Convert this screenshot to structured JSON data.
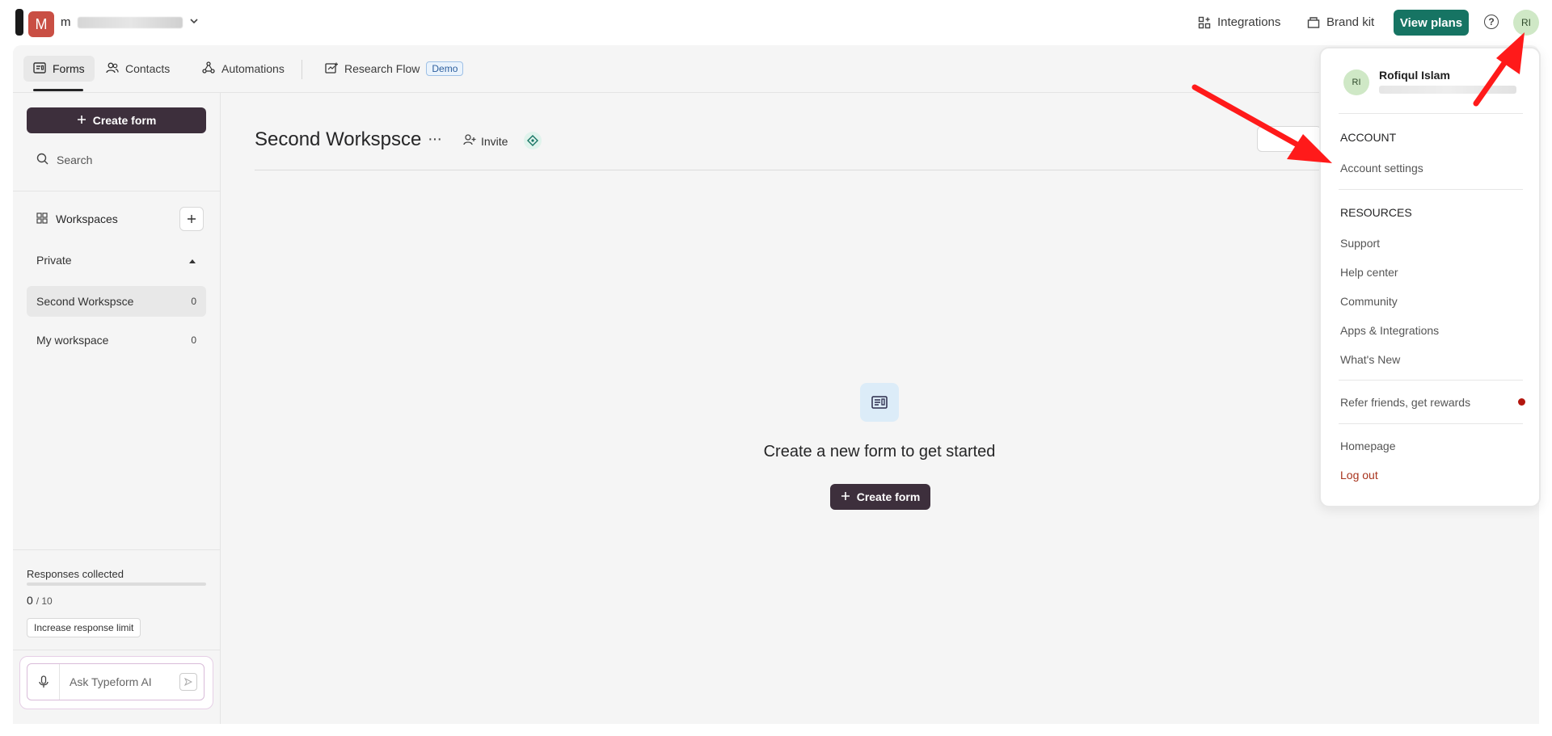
{
  "topbar": {
    "org_initial": "M",
    "org_name": "m",
    "integrations_label": "Integrations",
    "brand_kit_label": "Brand kit",
    "view_plans_label": "View plans",
    "help_glyph": "?",
    "user_initials": "RI"
  },
  "tabs": {
    "forms": "Forms",
    "contacts": "Contacts",
    "automations": "Automations",
    "research_flow": "Research Flow",
    "demo_badge": "Demo"
  },
  "sidebar": {
    "create_form_label": "Create form",
    "search_placeholder": "Search",
    "workspaces_label": "Workspaces",
    "private_label": "Private",
    "workspaces": [
      {
        "name": "Second Workspsce",
        "count": "0"
      },
      {
        "name": "My workspace",
        "count": "0"
      }
    ],
    "responses_label": "Responses collected",
    "responses_count": "0",
    "responses_limit": "/ 10",
    "increase_limit_label": "Increase response limit",
    "ai_placeholder": "Ask Typeform AI"
  },
  "main": {
    "workspace_title": "Second Workspsce",
    "dots": "···",
    "invite_label": "Invite",
    "empty_title": "Create a new form to get started",
    "empty_create_label": "Create form"
  },
  "dropdown": {
    "user_initials": "RI",
    "user_name": "Rofiqul Islam",
    "account_header": "ACCOUNT",
    "account_settings": "Account settings",
    "resources_header": "RESOURCES",
    "support": "Support",
    "help_center": "Help center",
    "community": "Community",
    "apps_integrations": "Apps & Integrations",
    "whats_new": "What's New",
    "refer": "Refer friends, get rewards",
    "homepage": "Homepage",
    "logout": "Log out"
  },
  "colors": {
    "accent_green": "#167463",
    "dark_button": "#3d2f3c",
    "annotation_red": "#ff1a1a",
    "logout_red": "#a8331d"
  },
  "icons": [
    "chevron-down-icon",
    "integrations-icon",
    "brand-kit-icon",
    "help-icon",
    "forms-icon",
    "contacts-icon",
    "automations-icon",
    "research-flow-icon",
    "plus-icon",
    "search-icon",
    "grid-icon",
    "caret-up-icon",
    "mic-icon",
    "send-icon",
    "invite-icon",
    "diamond-icon",
    "form-doc-icon"
  ]
}
